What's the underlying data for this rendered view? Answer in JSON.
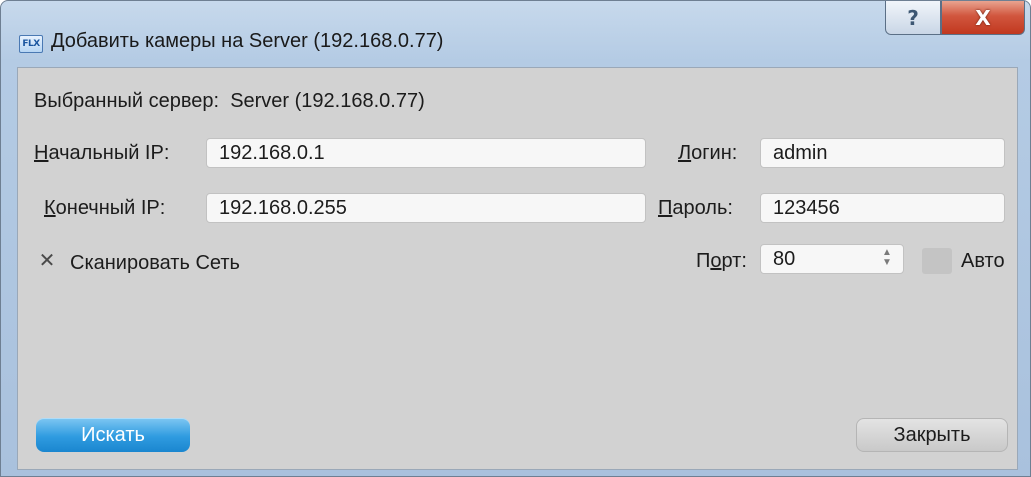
{
  "window": {
    "title": "Добавить камеры на Server (192.168.0.77)",
    "app_icon_text": "FLX",
    "help_label": "?",
    "close_label": "X"
  },
  "server": {
    "label": "Выбранный сервер:",
    "value": "Server (192.168.0.77)"
  },
  "start_ip": {
    "label_first": "Н",
    "label_rest": "ачальный IP:",
    "value": "192.168.0.1"
  },
  "end_ip": {
    "label_first": "К",
    "label_rest": "онечный IP:",
    "value": "192.168.0.255"
  },
  "login": {
    "label_first": "Л",
    "label_rest": "огин:",
    "value": "admin"
  },
  "password": {
    "label_first": "П",
    "label_rest": "ароль:",
    "value": "123456"
  },
  "port": {
    "label_first": "П",
    "label_mid": "о",
    "label_rest": "рт:",
    "value": "80",
    "spinner_glyph": "◆"
  },
  "auto": {
    "label": "Авто",
    "checked": false
  },
  "scan_network": {
    "label": "Сканировать Сеть",
    "checked": true,
    "check_glyph": "✕"
  },
  "buttons": {
    "search_label": "Искать",
    "close_label": "Закрыть"
  }
}
